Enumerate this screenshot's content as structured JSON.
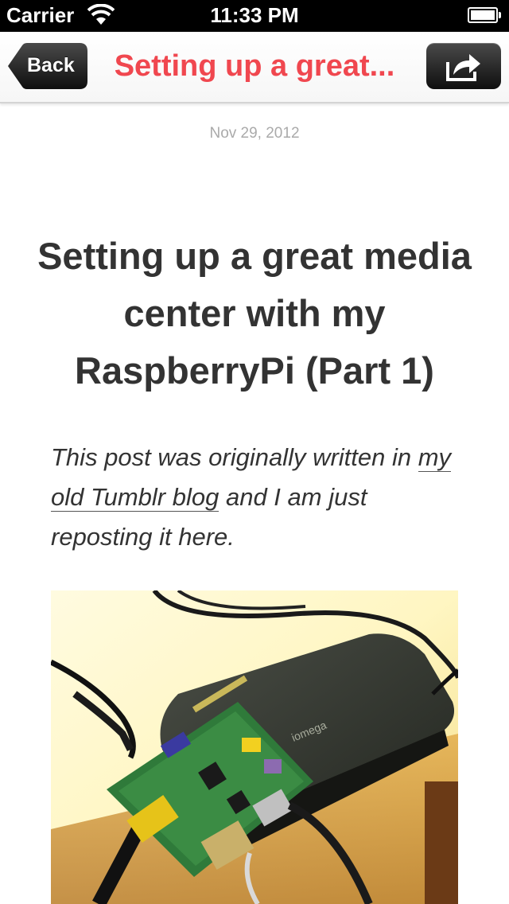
{
  "status_bar": {
    "carrier": "Carrier",
    "time": "11:33 PM"
  },
  "nav": {
    "back_label": "Back",
    "title": "Setting up a great...",
    "title_color": "#f0474f"
  },
  "post": {
    "date": "Nov 29, 2012",
    "title": "Setting up a great media center with my RaspberryPi (Part 1)",
    "intro_prefix": "This post was originally written in ",
    "intro_link": "my old Tumblr blog",
    "intro_suffix": " and I am just reposting it here."
  },
  "icons": {
    "wifi": "wifi-icon",
    "battery": "battery-icon",
    "share": "share-icon"
  }
}
